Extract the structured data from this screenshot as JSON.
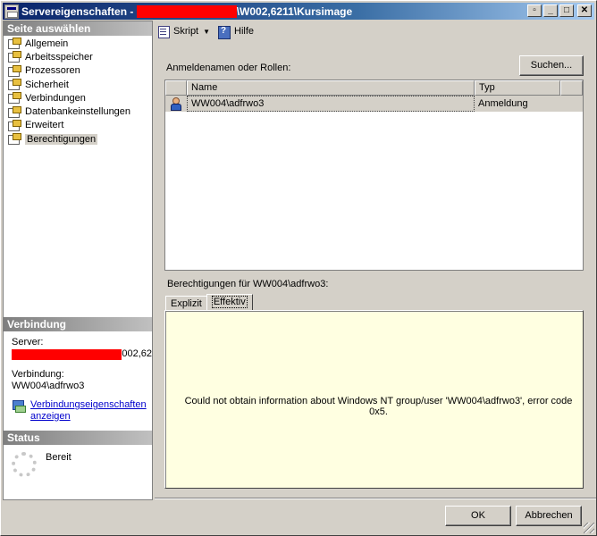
{
  "window": {
    "title_prefix": "Servereigenschaften - ",
    "title_suffix": "\\W002,6211\\Kursimage",
    "controls": [
      "▫",
      "_",
      "□",
      "✕"
    ]
  },
  "left_panel": {
    "select_page_header": "Seite auswählen",
    "pages": [
      {
        "label": "Allgemein",
        "selected": false
      },
      {
        "label": "Arbeitsspeicher",
        "selected": false
      },
      {
        "label": "Prozessoren",
        "selected": false
      },
      {
        "label": "Sicherheit",
        "selected": false
      },
      {
        "label": "Verbindungen",
        "selected": false
      },
      {
        "label": "Datenbankeinstellungen",
        "selected": false
      },
      {
        "label": "Erweitert",
        "selected": false
      },
      {
        "label": "Berechtigungen",
        "selected": true
      }
    ],
    "connection_header": "Verbindung",
    "server_label": "Server:",
    "server_value_suffix": "002,62",
    "connection_label": "Verbindung:",
    "connection_value": "WW004\\adfrwo3",
    "connection_link": "Verbindungseigenschaften anzeigen",
    "status_header": "Status",
    "status_value": "Bereit"
  },
  "toolbar": {
    "script_label": "Skript",
    "help_label": "Hilfe"
  },
  "main": {
    "logins_label": "Anmeldenamen oder Rollen:",
    "search_button": "Suchen...",
    "grid_columns": [
      "",
      "Name",
      "Typ",
      ""
    ],
    "grid_rows": [
      {
        "name": "WW004\\adfrwo3",
        "type": "Anmeldung"
      }
    ],
    "permissions_label": "Berechtigungen für WW004\\adfrwo3:",
    "tabs": [
      "Explizit",
      "Effektiv"
    ],
    "active_tab": "Effektiv",
    "error_message": "Could not obtain information about Windows NT group/user 'WW004\\adfrwo3', error code 0x5."
  },
  "buttons": {
    "ok": "OK",
    "cancel": "Abbrechen"
  }
}
